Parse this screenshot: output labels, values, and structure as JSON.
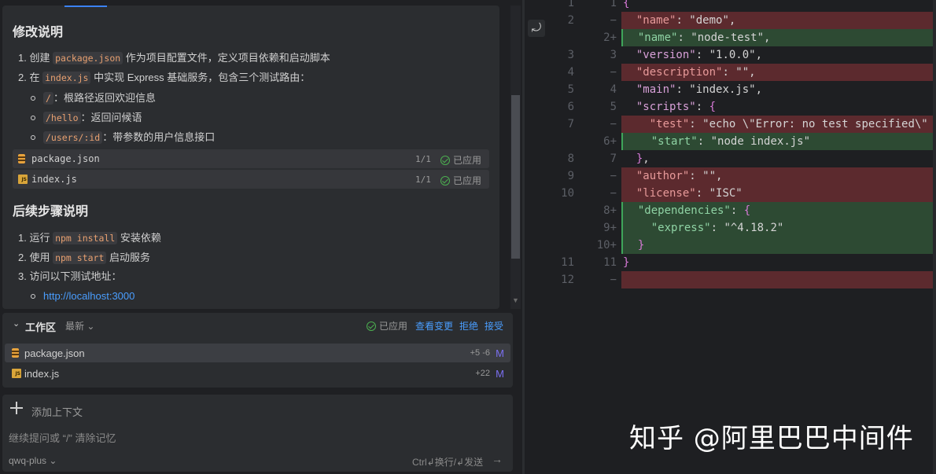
{
  "chat": {
    "section1_title": "修改说明",
    "ol1": [
      {
        "prefix": "1. 创建 ",
        "code": "package.json",
        "suffix": " 作为项目配置文件，定义项目依赖和启动脚本"
      },
      {
        "prefix": "2. 在 ",
        "code": "index.js",
        "suffix": " 中实现 Express 基础服务，包含三个测试路由："
      }
    ],
    "routes": [
      {
        "code": "/",
        "text": "：根路径返回欢迎信息"
      },
      {
        "code": "/hello",
        "text": "：返回问候语"
      },
      {
        "code": "/users/:id",
        "text": "：带参数的用户信息接口"
      }
    ],
    "files": [
      {
        "name": "package.json",
        "count": "1/1",
        "status": "已应用",
        "icon": "database-icon"
      },
      {
        "name": "index.js",
        "count": "1/1",
        "status": "已应用",
        "icon": "js-file-icon"
      }
    ],
    "section2_title": "后续步骤说明",
    "ol2": [
      {
        "prefix": "1. 运行 ",
        "code": "npm install",
        "suffix": " 安装依赖"
      },
      {
        "prefix": "2. 使用 ",
        "code": "npm start",
        "suffix": " 启动服务"
      },
      {
        "prefix": "3. 访问以下测试地址：",
        "code": "",
        "suffix": ""
      }
    ],
    "url": "http://localhost:3000"
  },
  "workspace": {
    "title": "工作区",
    "sort": "最新",
    "applied": "已应用",
    "view_changes": "查看变更",
    "reject": "拒绝",
    "accept": "接受",
    "files": [
      {
        "name": "package.json",
        "diff": "+5 -6",
        "status": "M",
        "icon": "database-icon"
      },
      {
        "name": "index.js",
        "diff": "+22",
        "status": "M",
        "icon": "js-file-icon"
      }
    ]
  },
  "input": {
    "add_context": "添加上下文",
    "placeholder": "继续提问或 “/” 清除记忆",
    "model": "qwq-plus",
    "send_hint": "Ctrl↲换行/↲发送"
  },
  "diff": {
    "lines": [
      {
        "old": "1",
        "new": "1",
        "type": "ctx",
        "code": "{"
      },
      {
        "old": "2",
        "new": "−",
        "type": "del",
        "code": "  \"name\": \"demo\","
      },
      {
        "old": "",
        "new": "2+",
        "type": "add",
        "code": "  \"name\": \"node-test\","
      },
      {
        "old": "3",
        "new": "3",
        "type": "ctx",
        "code": "  \"version\": \"1.0.0\","
      },
      {
        "old": "4",
        "new": "−",
        "type": "del",
        "code": "  \"description\": \"\","
      },
      {
        "old": "5",
        "new": "4",
        "type": "ctx",
        "code": "  \"main\": \"index.js\","
      },
      {
        "old": "6",
        "new": "5",
        "type": "ctx",
        "code": "  \"scripts\": {"
      },
      {
        "old": "7",
        "new": "−",
        "type": "del",
        "code": "    \"test\": \"echo \\\"Error: no test specified\\\""
      },
      {
        "old": "",
        "new": "6+",
        "type": "add",
        "code": "    \"start\": \"node index.js\""
      },
      {
        "old": "8",
        "new": "7",
        "type": "ctx",
        "code": "  },"
      },
      {
        "old": "9",
        "new": "−",
        "type": "del",
        "code": "  \"author\": \"\","
      },
      {
        "old": "10",
        "new": "−",
        "type": "del",
        "code": "  \"license\": \"ISC\""
      },
      {
        "old": "",
        "new": "8+",
        "type": "add",
        "code": "  \"dependencies\": {"
      },
      {
        "old": "",
        "new": "9+",
        "type": "add",
        "code": "    \"express\": \"^4.18.2\""
      },
      {
        "old": "",
        "new": "10+",
        "type": "add",
        "code": "  }"
      },
      {
        "old": "11",
        "new": "11",
        "type": "ctx",
        "code": "}"
      },
      {
        "old": "12",
        "new": "−",
        "type": "del",
        "code": ""
      }
    ]
  },
  "watermark": "知乎 @阿里巴巴中间件"
}
